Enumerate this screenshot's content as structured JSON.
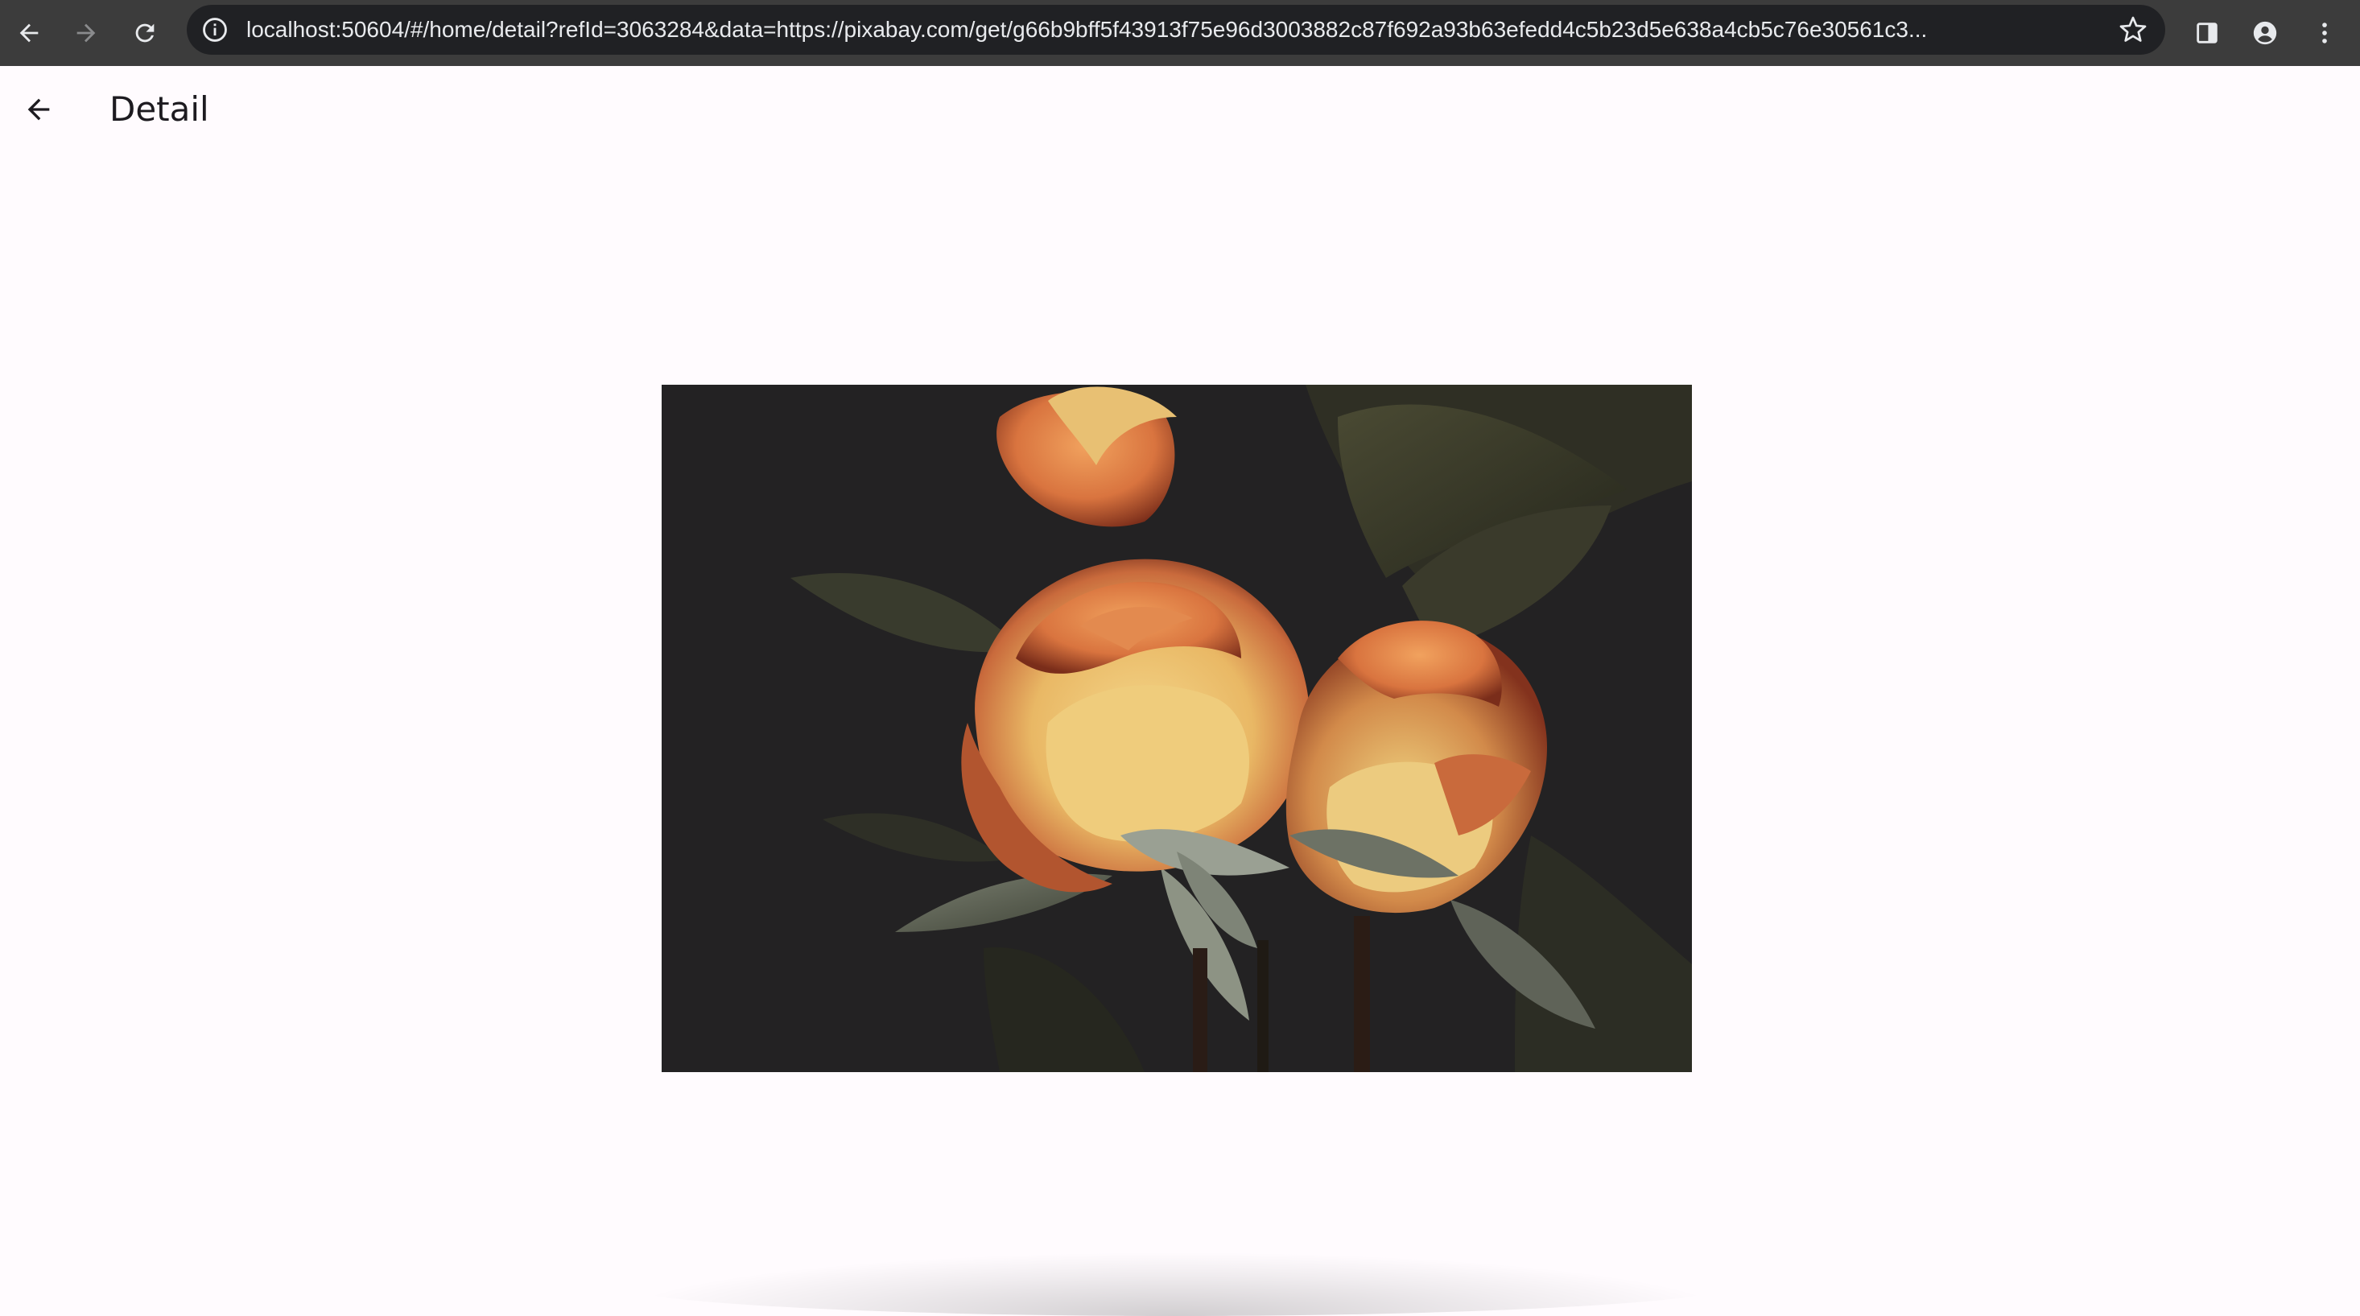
{
  "browser": {
    "url": "localhost:50604/#/home/detail?refId=3063284&data=https://pixabay.com/get/g66b9bff5f43913f75e96d3003882c87f692a93b63efedd4c5b23d5e638a4cb5c76e30561c3...",
    "icons": [
      "back-arrow-icon",
      "forward-arrow-icon",
      "reload-icon",
      "info-icon",
      "star-icon",
      "side-panel-icon",
      "profile-icon",
      "kebab-menu-icon"
    ]
  },
  "header": {
    "title": "Detail",
    "back_icon": "arrow-left-icon"
  },
  "colors": {
    "page_background": "#fffbfe",
    "browser_bar": "#3c3c3c",
    "omnibox": "#202124",
    "title_text": "#1d1b20"
  }
}
